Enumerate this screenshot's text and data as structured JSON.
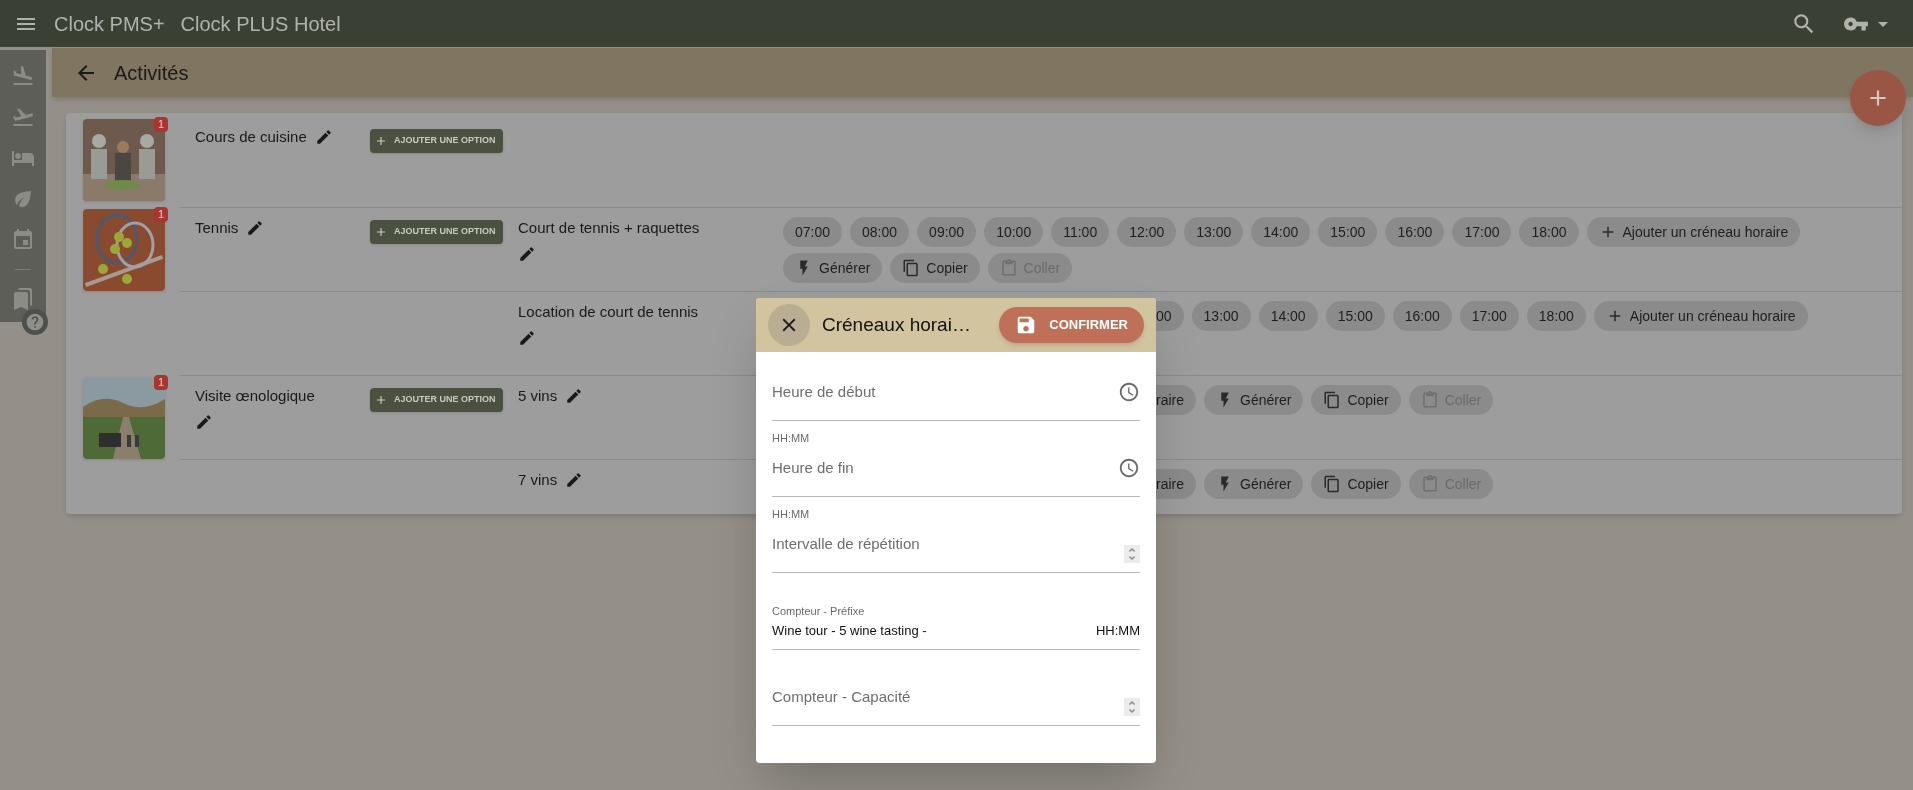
{
  "app_bar": {
    "product": "Clock PMS+",
    "hotel": "Clock PLUS Hotel"
  },
  "page": {
    "title": "Activités"
  },
  "activities": [
    {
      "name": "Cours de cuisine",
      "badge": "1",
      "add_option": "AJOUTER UNE OPTION"
    },
    {
      "name": "Tennis",
      "badge": "1",
      "add_option": "AJOUTER UNE OPTION",
      "options": [
        {
          "name": "Court de tennis + raquettes",
          "lines": [
            [
              {
                "kind": "time",
                "label": "07:00",
                "disabled": false
              },
              {
                "kind": "time",
                "label": "08:00",
                "disabled": false
              },
              {
                "kind": "time",
                "label": "09:00",
                "disabled": false
              },
              {
                "kind": "time",
                "label": "10:00",
                "disabled": false
              },
              {
                "kind": "time",
                "label": "11:00",
                "disabled": false
              },
              {
                "kind": "time",
                "label": "12:00",
                "disabled": false
              },
              {
                "kind": "time",
                "label": "13:00",
                "disabled": false
              },
              {
                "kind": "time",
                "label": "14:00",
                "disabled": false
              },
              {
                "kind": "time",
                "label": "15:00",
                "disabled": false
              },
              {
                "kind": "time",
                "label": "16:00",
                "disabled": false
              },
              {
                "kind": "time",
                "label": "17:00",
                "disabled": false
              },
              {
                "kind": "time",
                "label": "18:00",
                "disabled": false
              },
              {
                "kind": "add",
                "label": "Ajouter un créneau horaire",
                "disabled": false
              }
            ],
            [
              {
                "kind": "generate",
                "label": "Générer",
                "disabled": false
              },
              {
                "kind": "copy",
                "label": "Copier",
                "disabled": false
              },
              {
                "kind": "paste",
                "label": "Coller",
                "disabled": true
              }
            ]
          ]
        },
        {
          "name": "Location de court de tennis",
          "lines": [
            [
              {
                "kind": "cut",
                "label": "00",
                "disabled": false
              },
              {
                "kind": "time",
                "label": "13:00",
                "disabled": false
              },
              {
                "kind": "time",
                "label": "14:00",
                "disabled": false
              },
              {
                "kind": "time",
                "label": "15:00",
                "disabled": false
              },
              {
                "kind": "time",
                "label": "16:00",
                "disabled": false
              },
              {
                "kind": "time",
                "label": "17:00",
                "disabled": false
              },
              {
                "kind": "time",
                "label": "18:00",
                "disabled": false
              },
              {
                "kind": "add",
                "label": "Ajouter un créneau horaire",
                "disabled": false
              }
            ]
          ]
        }
      ]
    },
    {
      "name": "Visite œnologique",
      "badge": "1",
      "add_option": "AJOUTER UNE OPTION",
      "options": [
        {
          "name": "5 vins",
          "lines": [
            [
              {
                "kind": "cut",
                "label": "raire",
                "disabled": false
              },
              {
                "kind": "generate",
                "label": "Générer",
                "disabled": false
              },
              {
                "kind": "copy",
                "label": "Copier",
                "disabled": false
              },
              {
                "kind": "paste",
                "label": "Coller",
                "disabled": true
              }
            ]
          ]
        },
        {
          "name": "7 vins",
          "lines": [
            [
              {
                "kind": "cut",
                "label": "raire",
                "disabled": false
              },
              {
                "kind": "generate",
                "label": "Générer",
                "disabled": false
              },
              {
                "kind": "copy",
                "label": "Copier",
                "disabled": false
              },
              {
                "kind": "paste",
                "label": "Coller",
                "disabled": true
              }
            ]
          ]
        }
      ]
    }
  ],
  "dialog": {
    "title": "Créneaux horai…",
    "confirm": "CONFIRMER",
    "fields": [
      {
        "kind": "time",
        "placeholder": "Heure de début",
        "helper": "HH:MM"
      },
      {
        "kind": "time",
        "placeholder": "Heure de fin",
        "helper": "HH:MM"
      },
      {
        "kind": "number",
        "placeholder": "Intervalle de répétition"
      },
      {
        "kind": "text",
        "label": "Compteur - Préfixe",
        "value": "Wine tour - 5 wine tasting -",
        "suffix": "HH:MM"
      },
      {
        "kind": "number",
        "placeholder": "Compteur - Capacité"
      }
    ]
  }
}
